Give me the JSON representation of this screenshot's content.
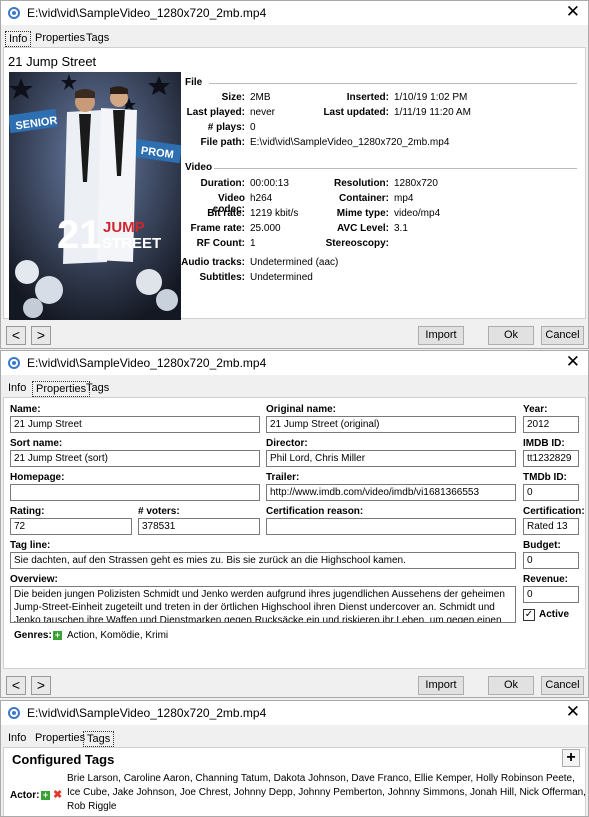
{
  "window_title": "E:\\vid\\vid\\SampleVideo_1280x720_2mb.mp4",
  "tabs": [
    "Info",
    "Properties",
    "Tags"
  ],
  "buttons": {
    "prev": "<",
    "next": ">",
    "import": "Import",
    "ok": "Ok",
    "cancel": "Cancel"
  },
  "info": {
    "title": "21 Jump Street",
    "poster": {
      "title_line1": "21",
      "title_line2": "JUMP",
      "title_line3": "STREET",
      "sign_left": "SENIOR",
      "sign_right": "PROM"
    },
    "file_section": "File",
    "file_left": [
      {
        "label": "Size:",
        "value": "2MB"
      },
      {
        "label": "Last played:",
        "value": "never"
      },
      {
        "label": "# plays:",
        "value": "0"
      },
      {
        "label": "File path:",
        "value": "E:\\vid\\vid\\SampleVideo_1280x720_2mb.mp4"
      }
    ],
    "file_right": [
      {
        "label": "Inserted:",
        "value": "1/10/19 1:02 PM"
      },
      {
        "label": "Last updated:",
        "value": "1/11/19 11:20 AM"
      }
    ],
    "video_section": "Video",
    "video_left": [
      {
        "label": "Duration:",
        "value": "00:00:13"
      },
      {
        "label": "Video codec:",
        "value": "h264"
      },
      {
        "label": "Bit rate:",
        "value": "1219 kbit/s"
      },
      {
        "label": "Frame rate:",
        "value": "25.000"
      },
      {
        "label": "RF Count:",
        "value": "1"
      }
    ],
    "video_right": [
      {
        "label": "Resolution:",
        "value": "1280x720"
      },
      {
        "label": "Container:",
        "value": "mp4"
      },
      {
        "label": "Mime type:",
        "value": "video/mp4"
      },
      {
        "label": "AVC Level:",
        "value": "3.1"
      },
      {
        "label": "Stereoscopy:",
        "value": ""
      }
    ],
    "audio_label": "Audio tracks:",
    "audio_value": "Undetermined (aac)",
    "subs_label": "Subtitles:",
    "subs_value": "Undetermined"
  },
  "properties": {
    "name_label": "Name:",
    "name": "21 Jump Street",
    "original_name_label": "Original name:",
    "original_name": "21 Jump Street (original)",
    "year_label": "Year:",
    "year": "2012",
    "sort_name_label": "Sort name:",
    "sort_name": "21 Jump Street (sort)",
    "director_label": "Director:",
    "director": "Phil Lord, Chris Miller",
    "imdb_label": "IMDB ID:",
    "imdb": "tt1232829",
    "homepage_label": "Homepage:",
    "homepage": "",
    "trailer_label": "Trailer:",
    "trailer": "http://www.imdb.com/video/imdb/vi1681366553",
    "tmdb_label": "TMDb ID:",
    "tmdb": "0",
    "rating_label": "Rating:",
    "rating": "72",
    "voters_label": "# voters:",
    "voters": "378531",
    "cert_reason_label": "Certification reason:",
    "cert_reason": "",
    "certification_label": "Certification:",
    "certification": "Rated 13",
    "tagline_label": "Tag line:",
    "tagline": "Sie dachten, auf den Strassen geht es mies zu. Bis sie zurück an die Highschool kamen.",
    "budget_label": "Budget:",
    "budget": "0",
    "overview_label": "Overview:",
    "overview_lines": [
      "Die beiden jungen Polizisten Schmidt und Jenko werden aufgrund ihres jugendlichen Aussehens der geheimen",
      "Jump-Street-Einheit zugeteilt und treten in der örtlichen Highschool ihren Dienst undercover an. Schmidt und",
      "Jenko tauschen ihre Waffen und Dienstmarken gegen Rucksäcke ein und riskieren ihr Leben, um gegen einen"
    ],
    "revenue_label": "Revenue:",
    "revenue": "0",
    "active_label": "Active",
    "active_checked": true,
    "genres_label": "Genres:",
    "genres": "Action, Komödie, Krimi"
  },
  "tags": {
    "heading": "Configured Tags",
    "add_button": "+",
    "actor_label": "Actor:",
    "actor_lines": [
      "Brie Larson,  Caroline Aaron,  Channing Tatum,  Dakota Johnson,  Dave Franco,  Ellie Kemper,  Holly Robinson Peete,",
      "Ice Cube,  Jake Johnson,  Joe Chrest,  Johnny Depp,  Johnny Pemberton,  Johnny Simmons,  Jonah Hill,  Nick Offerman,",
      "Rob Riggle"
    ]
  }
}
